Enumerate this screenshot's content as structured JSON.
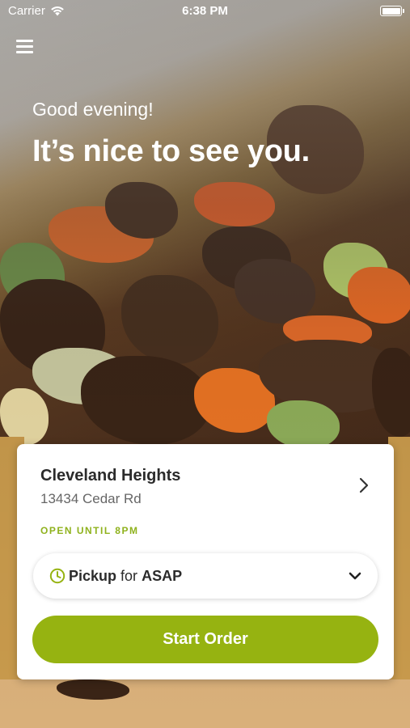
{
  "status_bar": {
    "carrier": "Carrier",
    "time": "6:38 PM"
  },
  "header": {
    "greeting": "Good evening!",
    "headline": "It’s nice to see you."
  },
  "location_card": {
    "name": "Cleveland Heights",
    "address": "13434 Cedar Rd",
    "hours": "OPEN UNTIL 8PM",
    "order_type": {
      "method": "Pickup",
      "connector": "for",
      "time": "ASAP"
    },
    "start_order_label": "Start Order"
  },
  "colors": {
    "accent": "#96b311",
    "hours_text": "#8fb21d"
  }
}
